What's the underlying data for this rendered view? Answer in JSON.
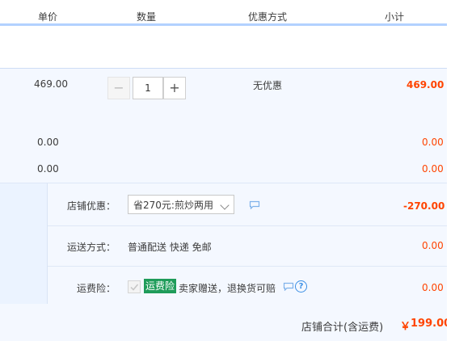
{
  "header": {
    "columns": [
      "单价",
      "数量",
      "优惠方式",
      "小计"
    ]
  },
  "item": {
    "unit_price": "469.00",
    "quantity": "1",
    "quantity_minus": "−",
    "quantity_plus": "+",
    "discount_method": "无优惠",
    "subtotal": "469.00"
  },
  "extra_rows": [
    {
      "price": "0.00",
      "subtotal": "0.00"
    },
    {
      "price": "0.00",
      "subtotal": "0.00"
    }
  ],
  "shop": {
    "coupon_label": "店铺优惠：",
    "coupon_selected": "省270元:煎炒两用",
    "coupon_amount": "-270.00",
    "shipping_label": "运送方式：",
    "shipping_value": "普通配送 快递 免邮",
    "shipping_amount": "0.00",
    "insurance_label": "运费险：",
    "insurance_badge": "运费险",
    "insurance_desc": "卖家赠送，退换货可赔",
    "insurance_help": "?",
    "insurance_amount": "0.00"
  },
  "total": {
    "label": "店铺合计(含运费)",
    "currency": "￥",
    "amount": "199.00"
  },
  "colors": {
    "accent_red": "#ff4400",
    "header_line": "#b2d1ff",
    "badge_green": "#1f9c5a",
    "help_blue": "#3b8fe5"
  },
  "icons": [
    "minus-icon",
    "plus-icon",
    "chevron-down-icon",
    "message-icon",
    "check-icon",
    "help-icon"
  ]
}
